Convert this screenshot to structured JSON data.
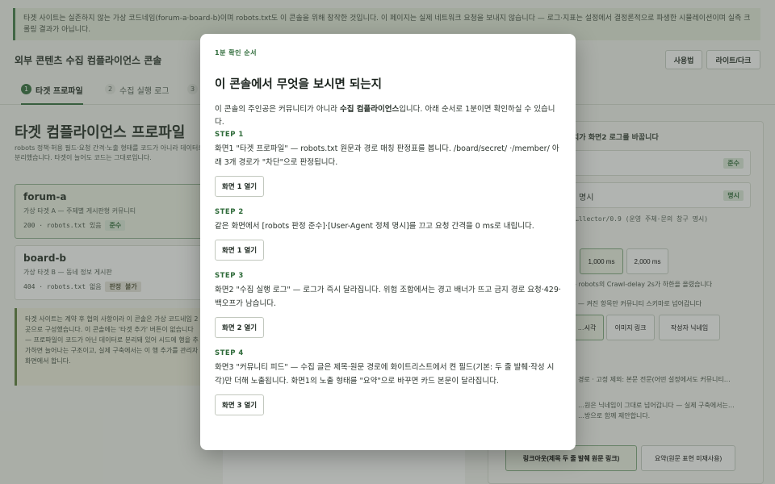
{
  "app": {
    "notice": "타겟 사이트는 실존하지 않는 가상 코드네임(forum-a·board-b)이며 robots.txt도 이 콘솔을 위해 창작한 것입니다. 이 페이지는 실제 네트워크 요청을 보내지 않습니다 — 로그·지표는 설정에서 결정론적으로 파생한 시뮬레이션이며 실측 크롤링 결과가 아닙니다.",
    "title": "외부 콘텐츠 수집 컴플라이언스 콘솔",
    "help_button": "사용법",
    "theme_button": "라이트/다크",
    "tabs": [
      {
        "num": "1",
        "label": "타겟 프로파일"
      },
      {
        "num": "2",
        "label": "수집 실행 로그"
      },
      {
        "num": "3",
        "label": ""
      }
    ],
    "page_title": "타겟 컴플라이언스 프로파일",
    "page_desc": "robots 정책·허용 필드·요청 간격·노출 형태를 코드가 아니라 데이터로 분리했습니다. 타겟이 늘어도 코드는 그대로입니다.",
    "sites": [
      {
        "name": "forum-a",
        "sub": "가상 타겟 A — 주제별 게시판형 커뮤니티",
        "meta": "200 · robots.txt 있음",
        "badge": "준수"
      },
      {
        "name": "board-b",
        "sub": "가상 타겟 B — 동네 정보 게시판",
        "meta": "404 · robots.txt 없음",
        "badge": "판정 불가"
      }
    ],
    "side_note": "타겟 사이트는 계약 후 협의 사항이라 이 콘솔은 가상 코드네임 2곳으로 구성했습니다. 이 콘솔에는 '타겟 추가' 버튼이 없습니다 — 프로파일이 코드가 아닌 데이터로 분리돼 있어 시드에 행을 추가하면 늘어나는 구조이고, 실제 구축에서는 이 행 추가를 관리자 화면에서 합니다.",
    "right_head": "…치가 화면2 로그를 바꿉니다",
    "right_rows": [
      {
        "label": "",
        "badge": "준수"
      },
      {
        "label": "명시",
        "badge": "명시"
      }
    ],
    "ua_text": "…llector/0.9 (운영 주체·문의 창구 명시)",
    "interval_buttons": [
      "1,000 ms",
      "2,000 ms"
    ],
    "crawl_delay_note": "— robots의 Crawl-delay 2s가 하한을 올렸습니다",
    "fields_note": "트 — 켜진 항목만 커뮤니티 스키마로 넘어갑니다",
    "field_buttons": [
      "…시각",
      "이미지 링크",
      "작성자 닉네임"
    ],
    "exposure_note_1": "경로 · 고정 제외: 본문 전문(어떤 설정에서도 커뮤니티…",
    "exposure_note_2": "…원은 닉네임이 그대로 넘어갑니다 — 실제 구축에서는…",
    "exposure_note_3": "…방으로 함께 제안합니다.",
    "exposure_buttons": [
      "링크아웃(제목 두 줄 발췌 원문 링크)",
      "요약(원문 표현 미재사용)"
    ]
  },
  "modal": {
    "eyebrow": "1분 확인 순서",
    "title": "이 콘솔에서 무엇을 보시면 되는지",
    "intro_before": "이 콘솔의 주인공은 커뮤니티가 아니라 ",
    "intro_bold": "수집 컴플라이언스",
    "intro_after": "입니다. 아래 순서로 1분이면 확인하실 수 있습니다.",
    "steps": [
      {
        "label": "STEP 1",
        "text": "화면1 \"타겟 프로파일\" — robots.txt 원문과 경로 매칭 판정표를 봅니다. /board/secret/ ·/member/ 아래 3개 경로가 \"차단\"으로 판정됩니다.",
        "button": "화면 1 열기"
      },
      {
        "label": "STEP 2",
        "text": "같은 화면에서 [robots 판정 준수]·[User-Agent 정체 명시]를 끄고 요청 간격을 0 ms로 내립니다.",
        "button": "화면 1 열기"
      },
      {
        "label": "STEP 3",
        "text": "화면2 \"수집 실행 로그\" — 로그가 즉시 달라집니다. 위험 조합에서는 경고 배너가 뜨고 금지 경로 요청·429·백오프가 남습니다.",
        "button": "화면 2 열기"
      },
      {
        "label": "STEP 4",
        "text": "화면3 \"커뮤니티 피드\" — 수집 글은 제목·원문 경로에 화이트리스트에서 켠 필드(기본: 두 줄 발췌·작성 시각)만 더해 노출됩니다. 화면1의 노출 형태를 \"요약\"으로 바꾸면 카드 본문이 달라집니다.",
        "button": "화면 3 열기"
      }
    ]
  },
  "colors": {
    "accent": "#2f6b3a",
    "overlay": "rgba(70,76,68,0.42)",
    "modal_bg": "#ffffff"
  }
}
